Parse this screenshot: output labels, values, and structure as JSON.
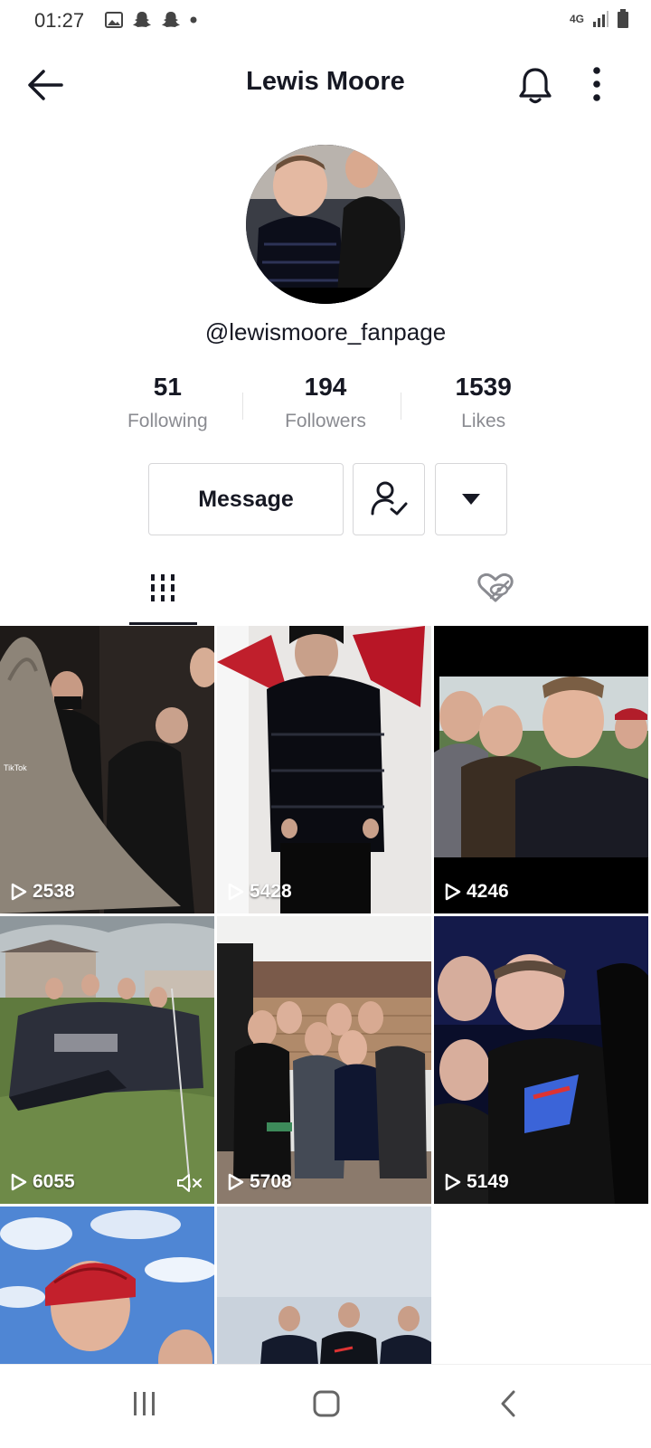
{
  "status_bar": {
    "time": "01:27",
    "network": "4G"
  },
  "header": {
    "title": "Lewis Moore"
  },
  "profile": {
    "handle": "@lewismoore_fanpage",
    "stats": [
      {
        "value": "51",
        "label": "Following"
      },
      {
        "value": "194",
        "label": "Followers"
      },
      {
        "value": "1539",
        "label": "Likes"
      }
    ],
    "message_label": "Message"
  },
  "tabs": {
    "active": "videos",
    "items": [
      "videos",
      "liked"
    ]
  },
  "videos": [
    {
      "views": "2538",
      "muted": false
    },
    {
      "views": "5428",
      "muted": false
    },
    {
      "views": "4246",
      "muted": false
    },
    {
      "views": "6055",
      "muted": true
    },
    {
      "views": "5708",
      "muted": false
    },
    {
      "views": "5149",
      "muted": false
    },
    {
      "views": "",
      "muted": false
    },
    {
      "views": "",
      "muted": false
    }
  ],
  "colors": {
    "text_primary": "#161823",
    "text_secondary": "#8a8b91",
    "border": "#d6d6d8"
  }
}
